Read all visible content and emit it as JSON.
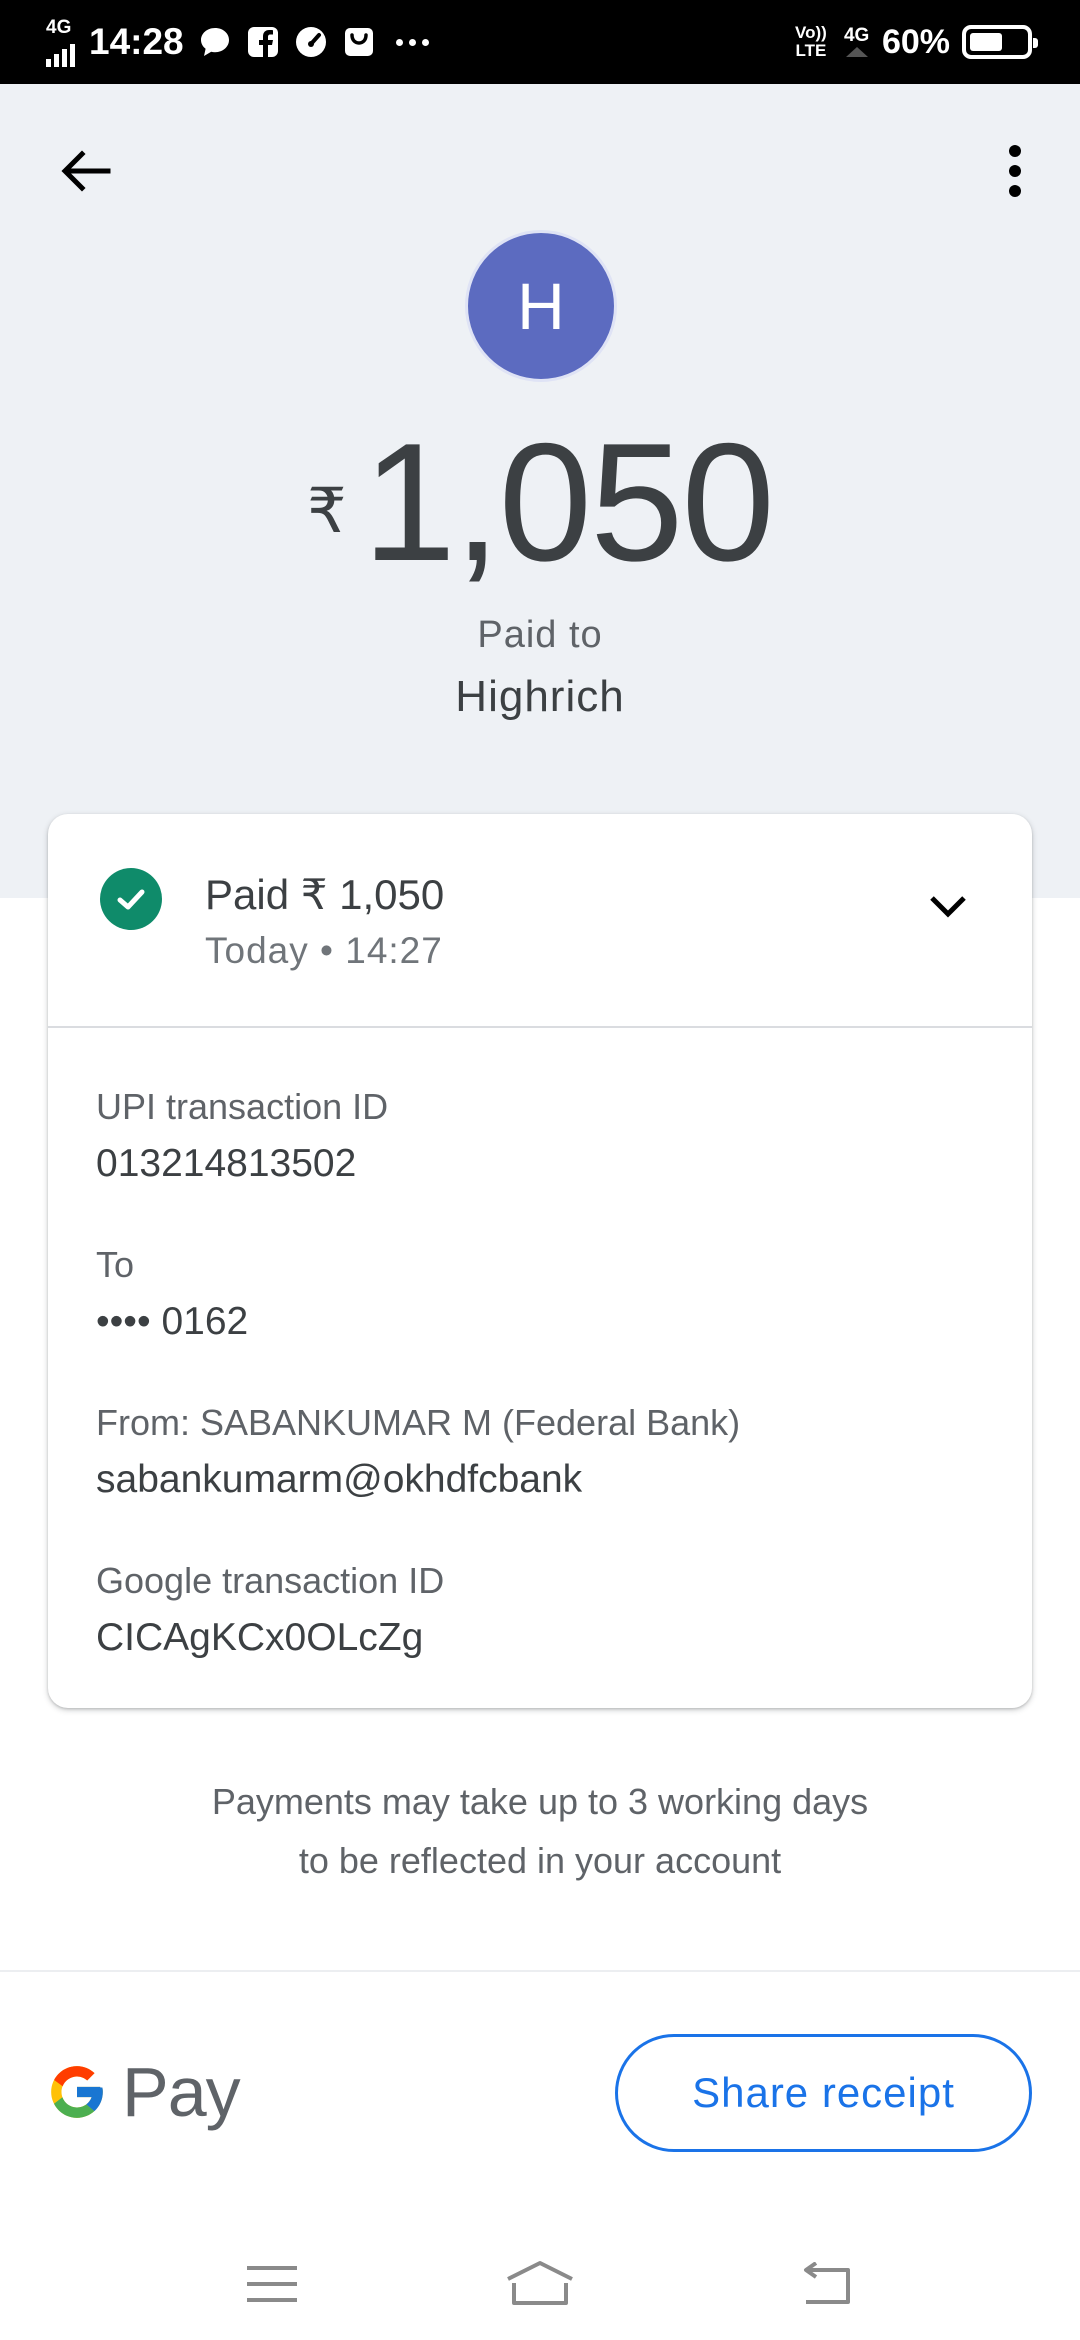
{
  "status_bar": {
    "network": "4G",
    "time": "14:28",
    "volte": "Vo)) LTE",
    "network_right": "4G",
    "battery": "60%",
    "battery_level": 0.6,
    "notification_icons": [
      "chat-icon",
      "facebook-icon",
      "speedometer-icon",
      "shopping-bag-icon"
    ]
  },
  "header": {
    "avatar_initial": "H",
    "avatar_color": "#5c6bc0",
    "currency_symbol": "₹",
    "amount": "1,050",
    "paid_to_label": "Paid to",
    "payee": "Highrich"
  },
  "card": {
    "status_text": "Paid ₹ 1,050",
    "date_text": "Today • 14:27",
    "status_color": "#0f8b6a",
    "details": [
      {
        "label": "UPI transaction ID",
        "value": "013214813502"
      },
      {
        "label": "To",
        "value": "•••• 0162"
      },
      {
        "label": "From: SABANKUMAR M (Federal Bank)",
        "value": "sabankumarm@okhdfcbank"
      },
      {
        "label": "Google transaction ID",
        "value": "CICAgKCx0OLcZg"
      }
    ]
  },
  "note": {
    "line1": "Payments may take up to 3 working days",
    "line2": "to be reflected in your account"
  },
  "footer": {
    "logo_text": "Pay",
    "share_label": "Share receipt",
    "accent": "#1a73e8"
  }
}
